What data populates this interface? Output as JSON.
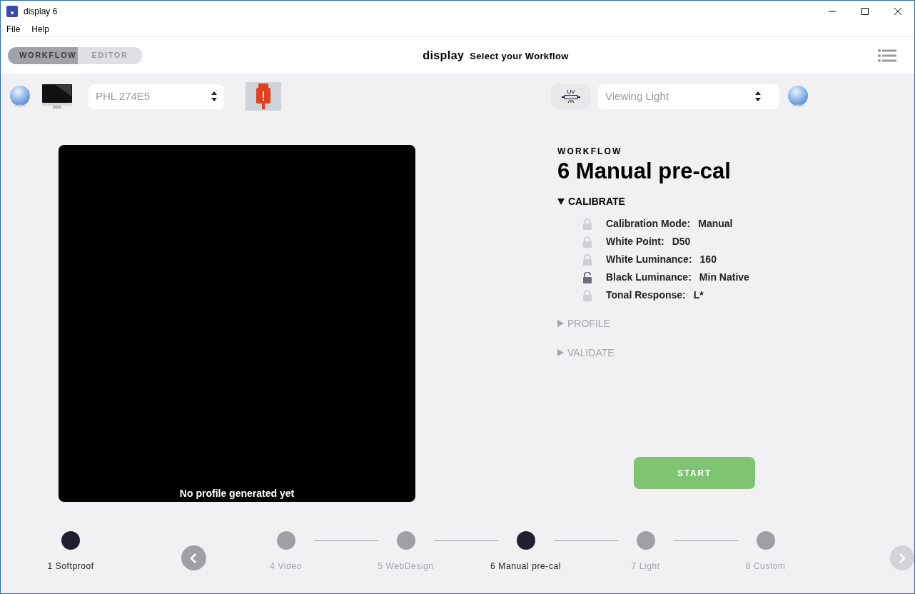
{
  "window": {
    "title": "display 6"
  },
  "menu": [
    "File",
    "Help"
  ],
  "mode_tabs": [
    {
      "label": "WORKFLOW",
      "selected": true
    },
    {
      "label": "EDITOR",
      "selected": false
    }
  ],
  "header": {
    "brand": "display",
    "subtitle": "Select your Workflow"
  },
  "display_select": {
    "value": "PHL 274E5"
  },
  "light_select": {
    "placeholder": "Viewing Light"
  },
  "light_badge": "UV",
  "preview": {
    "caption": "No profile generated yet"
  },
  "workflow": {
    "eyebrow": "WORKFLOW",
    "title": "6 Manual pre-cal",
    "sections": [
      {
        "label": "CALIBRATE",
        "expanded": true,
        "settings": [
          {
            "label": "Calibration Mode:",
            "value": "Manual",
            "locked": true
          },
          {
            "label": "White Point:",
            "value": "D50",
            "locked": true
          },
          {
            "label": "White Luminance:",
            "value": "160",
            "locked": true
          },
          {
            "label": "Black Luminance:",
            "value": "Min Native",
            "locked": false
          },
          {
            "label": "Tonal Response:",
            "value": "L*",
            "locked": true
          }
        ]
      },
      {
        "label": "PROFILE",
        "expanded": false
      },
      {
        "label": "VALIDATE",
        "expanded": false
      }
    ]
  },
  "start_button": "START",
  "pinned_step": {
    "label": "1 Softproof",
    "selected": true
  },
  "steps": [
    {
      "label": "4 Video",
      "selected": false
    },
    {
      "label": "5 WebDesign",
      "selected": false
    },
    {
      "label": "6 Manual pre-cal",
      "selected": true
    },
    {
      "label": "7 Light",
      "selected": false
    },
    {
      "label": "8 Custom",
      "selected": false
    }
  ],
  "nav": {
    "prev_disabled": false,
    "next_disabled": true
  }
}
